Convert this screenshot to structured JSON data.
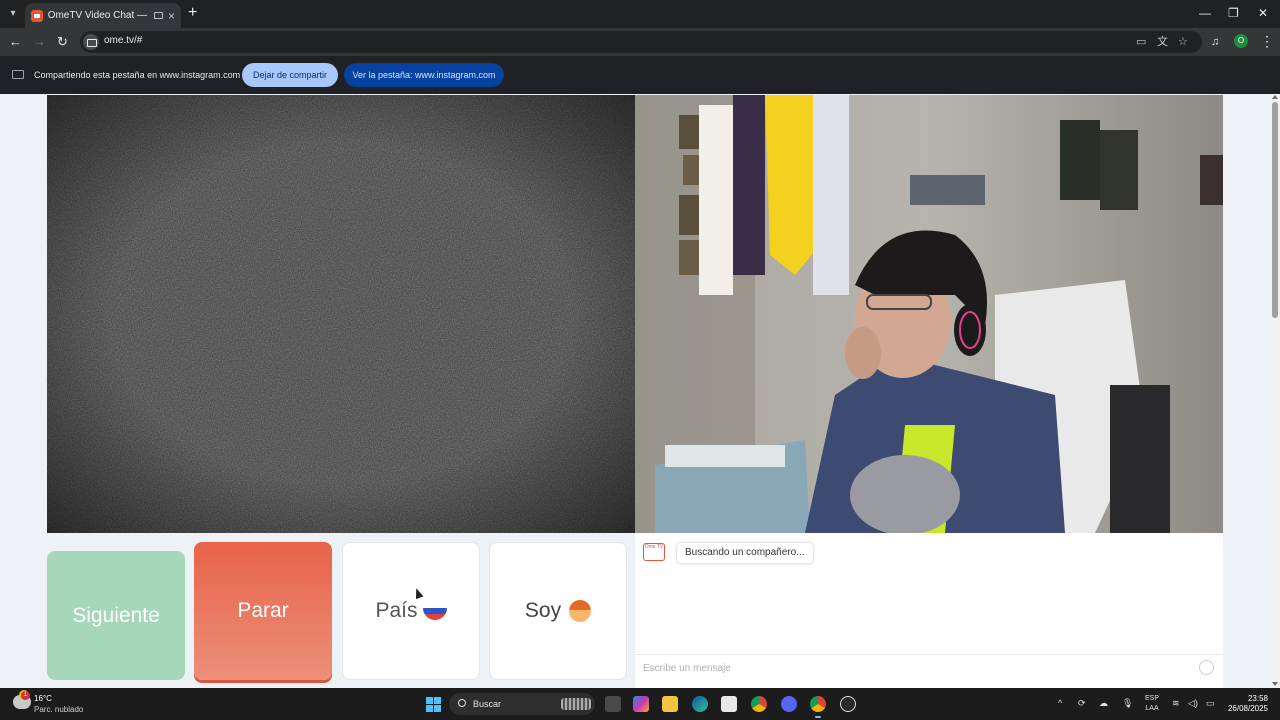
{
  "browser": {
    "tab_title": "OmeTV Video Chat — Ome",
    "new_tab_symbol": "+",
    "url": "ome.tv/#",
    "profile_initial": "O",
    "window_controls": {
      "minimize": "—",
      "maximize": "❐",
      "close": "✕"
    }
  },
  "share_bar": {
    "message": "Compartiendo esta pestaña en www.instagram.com",
    "stop_label": "Dejar de compartir",
    "view_label": "Ver la pestaña: www.instagram.com"
  },
  "controls": {
    "next_label": "Siguiente",
    "stop_label": "Parar",
    "country_label": "País",
    "gender_label": "Soy"
  },
  "chat": {
    "logo_text": "Ome TV",
    "status_message": "Buscando un compañero...",
    "input_placeholder": "Escribe un mensaje"
  },
  "taskbar": {
    "weather_temp": "16°C",
    "weather_desc": "Parc. nublado",
    "weather_badge": "1",
    "search_label": "Buscar",
    "lang_top": "ESP",
    "lang_bottom": "LAA",
    "time": "23:58",
    "date": "26/08/2025"
  },
  "colors": {
    "next_button": "#a6d7b9",
    "stop_button": "#e8634a",
    "share_stop_button": "#a8c7fa",
    "share_view_button": "#0842a0",
    "ome_brand": "#e4573d"
  }
}
